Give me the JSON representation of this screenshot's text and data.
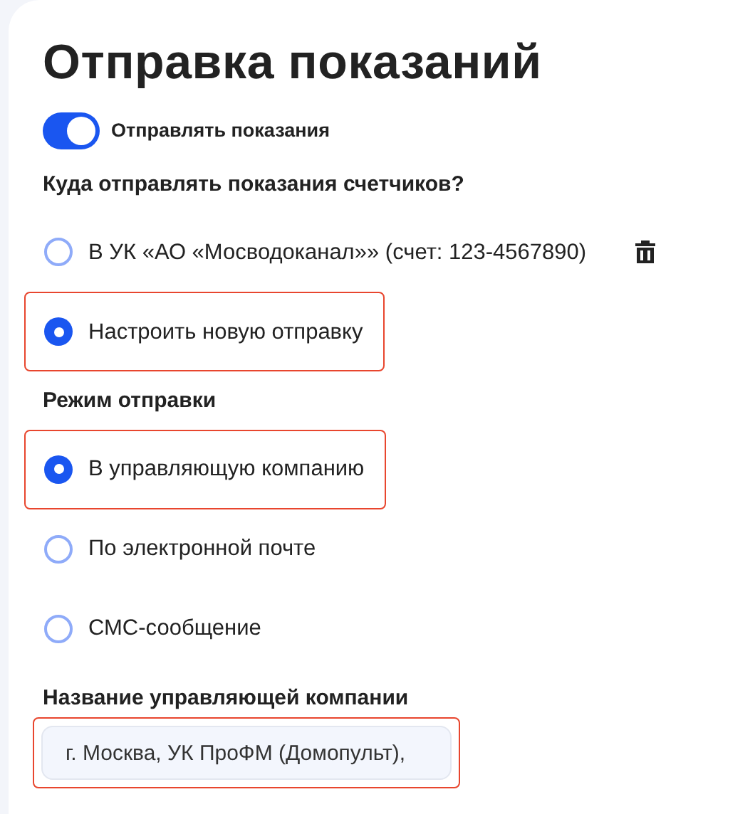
{
  "title": "Отправка показаний",
  "toggle": {
    "label": "Отправлять показания",
    "on": true
  },
  "destination": {
    "heading": "Куда отправлять показания счетчиков?",
    "options": [
      {
        "label": "В УК «АО «Мосводоканал»» (счет: 123-4567890)",
        "selected": false,
        "deletable": true,
        "highlighted": false
      },
      {
        "label": "Настроить новую отправку",
        "selected": true,
        "deletable": false,
        "highlighted": true
      }
    ]
  },
  "mode": {
    "heading": "Режим отправки",
    "options": [
      {
        "label": "В управляющую компанию",
        "selected": true,
        "highlighted": true
      },
      {
        "label": "По электронной почте",
        "selected": false,
        "highlighted": false
      },
      {
        "label": "СМС-сообщение",
        "selected": false,
        "highlighted": false
      }
    ]
  },
  "company": {
    "label": "Название управляющей компании",
    "value": "г. Москва, УК ПроФМ (Домопульт),",
    "highlighted": true
  }
}
